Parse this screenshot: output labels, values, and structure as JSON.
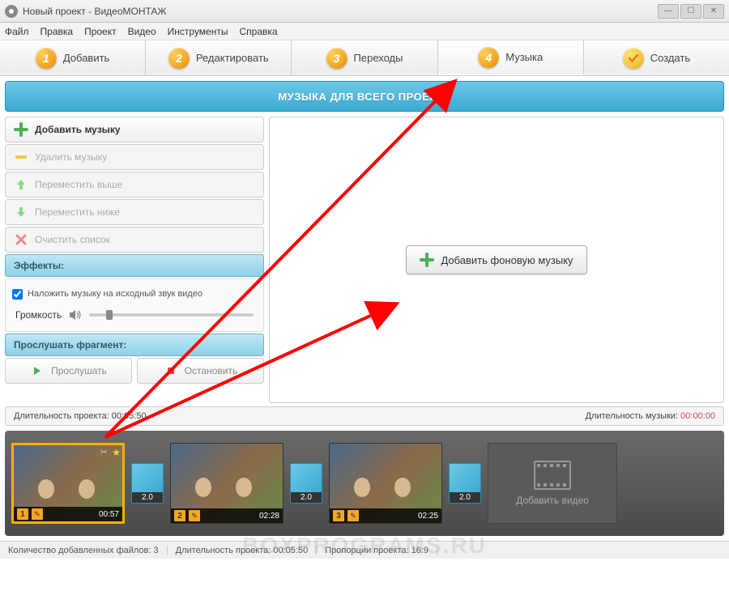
{
  "window": {
    "title": "Новый проект - ВидеоМОНТАЖ"
  },
  "menu": {
    "file": "Файл",
    "edit": "Правка",
    "project": "Проект",
    "video": "Видео",
    "tools": "Инструменты",
    "help": "Справка"
  },
  "steps": {
    "s1": "Добавить",
    "s2": "Редактировать",
    "s3": "Переходы",
    "s4": "Музыка",
    "s5": "Создать"
  },
  "header": {
    "title": "МУЗЫКА ДЛЯ ВСЕГО ПРОЕКТА"
  },
  "music_panel": {
    "add": "Добавить музыку",
    "delete": "Удалить музыку",
    "move_up": "Переместить выше",
    "move_down": "Переместить ниже",
    "clear": "Очистить список",
    "effects_header": "Эффекты:",
    "overlay_checkbox": "Наложить музыку на исходный звук видео",
    "volume_label": "Громкость",
    "preview_header": "Прослушать фрагмент:",
    "play": "Прослушать",
    "stop": "Остановить"
  },
  "preview": {
    "add_bg": "Добавить фоновую музыку"
  },
  "duration_bar": {
    "project_label": "Длительность проекта:",
    "project_value": "00:05:50",
    "music_label": "Длительность музыки:",
    "music_value": "00:00:00"
  },
  "timeline": {
    "clips": [
      {
        "num": "1",
        "time": "00:57"
      },
      {
        "num": "2",
        "time": "02:28"
      },
      {
        "num": "3",
        "time": "02:25"
      }
    ],
    "transition_value": "2.0",
    "add_video": "Добавить видео"
  },
  "status": {
    "files_label": "Количество добавленных файлов:",
    "files_value": "3",
    "duration_label": "Длительность проекта:",
    "duration_value": "00:05:50",
    "aspect_label": "Пропорции проекта:",
    "aspect_value": "16:9"
  },
  "watermark": "BOXPROGRAMS.RU"
}
